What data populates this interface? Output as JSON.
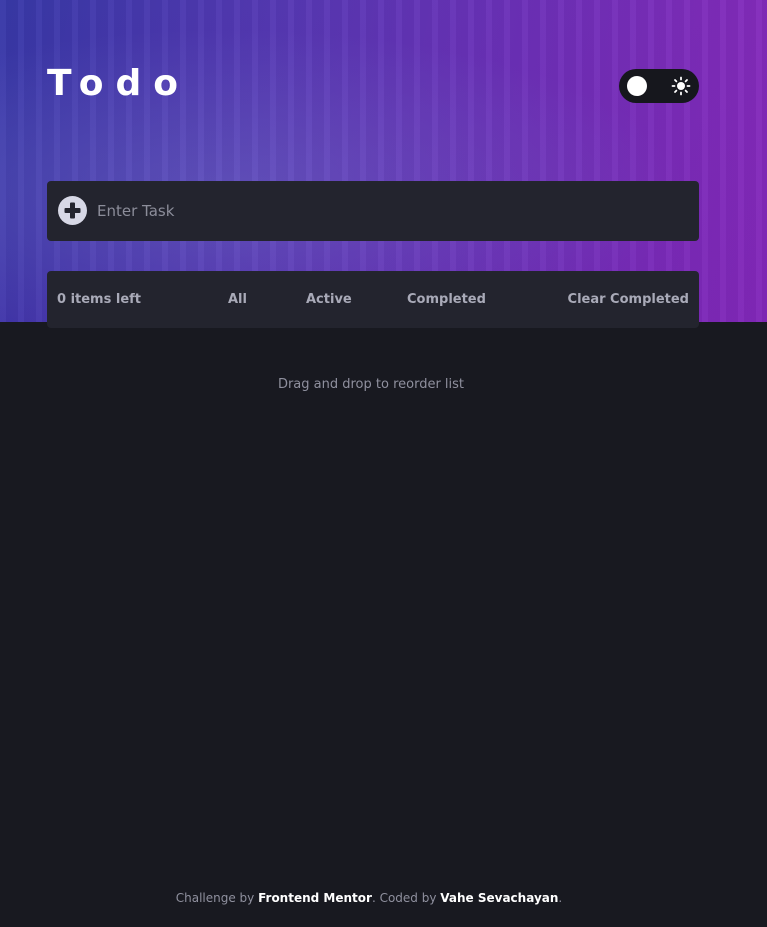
{
  "header": {
    "title": "Todo",
    "theme_toggle": {
      "state": "dark",
      "icon": "sun-icon"
    }
  },
  "new_task": {
    "icon": "plus-circle-icon",
    "placeholder": "Enter Task",
    "value": ""
  },
  "footer": {
    "items_left": "0 items left",
    "filters": {
      "all": "All",
      "active": "Active",
      "completed": "Completed"
    },
    "clear_completed": "Clear Completed"
  },
  "hint": "Drag and drop to reorder list",
  "credit": {
    "prefix": "Challenge by ",
    "challenge_link": "Frontend Mentor",
    "middle": ". Coded by ",
    "author_link": "Vahe Sevachayan",
    "suffix": "."
  },
  "colors": {
    "background": "#181920",
    "panel": "#23242e",
    "text_muted": "#a9aab8",
    "accent_gradient_start": "#3a3fb0",
    "accent_gradient_end": "#9a2ec8"
  }
}
